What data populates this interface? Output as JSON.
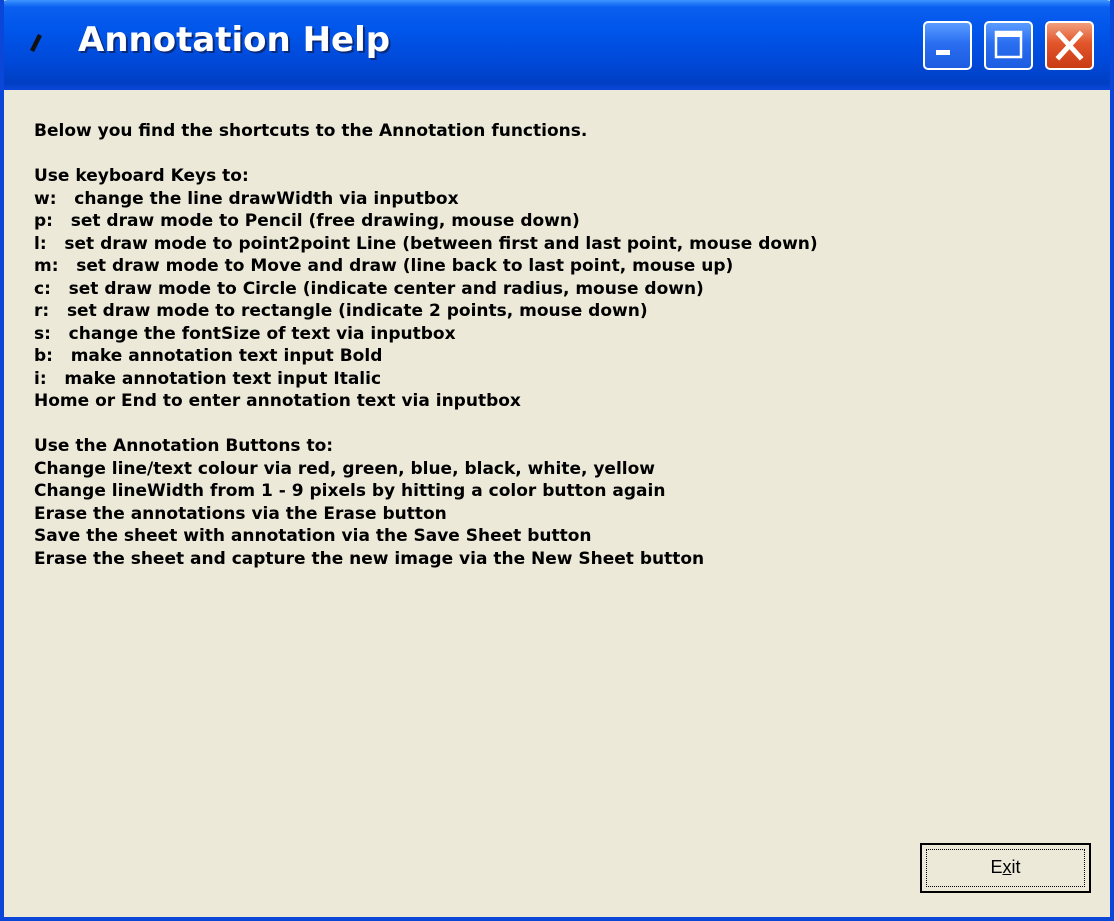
{
  "window": {
    "title": "Annotation Help",
    "title_icon": "pen-icon",
    "controls": [
      {
        "name": "minimize-button",
        "icon": "minimize-icon"
      },
      {
        "name": "maximize-button",
        "icon": "maximize-icon"
      },
      {
        "name": "close-button",
        "icon": "close-icon"
      }
    ]
  },
  "content": {
    "intro": "Below you find the shortcuts to the Annotation functions.",
    "keys_heading": "Use keyboard Keys to:",
    "keys": [
      "w:   change the line drawWidth via inputbox",
      "p:   set draw mode to Pencil (free drawing, mouse down)",
      "l:   set draw mode to point2point Line (between first and last point, mouse down)",
      "m:   set draw mode to Move and draw (line back to last point, mouse up)",
      "c:   set draw mode to Circle (indicate center and radius, mouse down)",
      "r:   set draw mode to rectangle (indicate 2 points, mouse down)",
      "s:   change the fontSize of text via inputbox",
      "b:   make annotation text input Bold",
      "i:   make annotation text input Italic",
      "Home or End to enter annotation text via inputbox"
    ],
    "buttons_heading": "Use the Annotation Buttons to:",
    "buttons": [
      "Change line/text colour via red, green, blue, black, white, yellow",
      "Change lineWidth from 1 - 9 pixels by hitting a color button again",
      "Erase the annotations via the Erase button",
      "Save the sheet with annotation via the Save Sheet button",
      "Erase the sheet and capture the new image via the New Sheet button"
    ]
  },
  "exit_button": {
    "label_prefix": "E",
    "label_accel": "x",
    "label_suffix": "it"
  },
  "colors": {
    "title_bar": "#0055ea",
    "window_border": "#0a46d8",
    "client_bg": "#ece9d8",
    "close_button": "#e2542a"
  }
}
